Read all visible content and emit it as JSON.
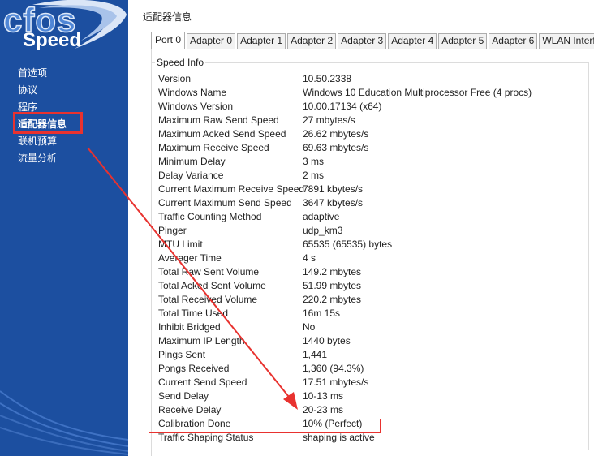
{
  "sidebar": {
    "logo_top": "cfos",
    "logo_bottom": "Speed",
    "items": [
      {
        "label": "首选项"
      },
      {
        "label": "协议"
      },
      {
        "label": "程序"
      },
      {
        "label": "适配器信息",
        "active": true
      },
      {
        "label": "联机预算"
      },
      {
        "label": "流量分析"
      }
    ]
  },
  "main": {
    "title": "适配器信息",
    "tabs": [
      {
        "label": "Port 0",
        "active": true
      },
      {
        "label": "Adapter 0"
      },
      {
        "label": "Adapter 1"
      },
      {
        "label": "Adapter 2"
      },
      {
        "label": "Adapter 3"
      },
      {
        "label": "Adapter 4"
      },
      {
        "label": "Adapter 5"
      },
      {
        "label": "Adapter 6"
      },
      {
        "label": "WLAN Interface"
      }
    ],
    "group_title": "Speed Info",
    "rows": [
      {
        "key": "Version",
        "value": "10.50.2338"
      },
      {
        "key": "Windows Name",
        "value": "Windows 10 Education Multiprocessor Free (4 procs)"
      },
      {
        "key": "Windows Version",
        "value": "10.00.17134 (x64)"
      },
      {
        "key": "Maximum Raw Send Speed",
        "value": "27 mbytes/s"
      },
      {
        "key": "Maximum Acked Send Speed",
        "value": "26.62 mbytes/s"
      },
      {
        "key": "Maximum Receive Speed",
        "value": "69.63 mbytes/s"
      },
      {
        "key": "Minimum Delay",
        "value": "3 ms"
      },
      {
        "key": "Delay Variance",
        "value": "2 ms"
      },
      {
        "key": "Current Maximum Receive Speed",
        "value": "7891 kbytes/s"
      },
      {
        "key": "Current Maximum Send Speed",
        "value": "3647 kbytes/s"
      },
      {
        "key": "Traffic Counting Method",
        "value": "adaptive"
      },
      {
        "key": "Pinger",
        "value": "udp_km3"
      },
      {
        "key": "MTU Limit",
        "value": "65535 (65535) bytes"
      },
      {
        "key": "Averager Time",
        "value": "4 s"
      },
      {
        "key": "Total Raw Sent Volume",
        "value": "149.2 mbytes"
      },
      {
        "key": "Total Acked Sent Volume",
        "value": "51.99 mbytes"
      },
      {
        "key": "Total Received Volume",
        "value": "220.2 mbytes"
      },
      {
        "key": "Total Time Used",
        "value": "16m 15s"
      },
      {
        "key": "Inhibit Bridged",
        "value": "No"
      },
      {
        "key": "Maximum IP Length",
        "value": "1440 bytes"
      },
      {
        "key": "Pings Sent",
        "value": "1,441"
      },
      {
        "key": "Pongs Received",
        "value": "1,360 (94.3%)"
      },
      {
        "key": "Current Send Speed",
        "value": "17.51 mbytes/s"
      },
      {
        "key": "Send Delay",
        "value": "10-13 ms"
      },
      {
        "key": "Receive Delay",
        "value": "20-23 ms"
      },
      {
        "key": "Calibration Done",
        "value": "10% (Perfect)"
      },
      {
        "key": "Traffic Shaping Status",
        "value": "shaping is active"
      }
    ]
  },
  "annotation": {
    "color": "#e8322f"
  },
  "colors": {
    "sidebar_bg": "#1c4fa0",
    "logo_accent": "#4f86d6"
  }
}
